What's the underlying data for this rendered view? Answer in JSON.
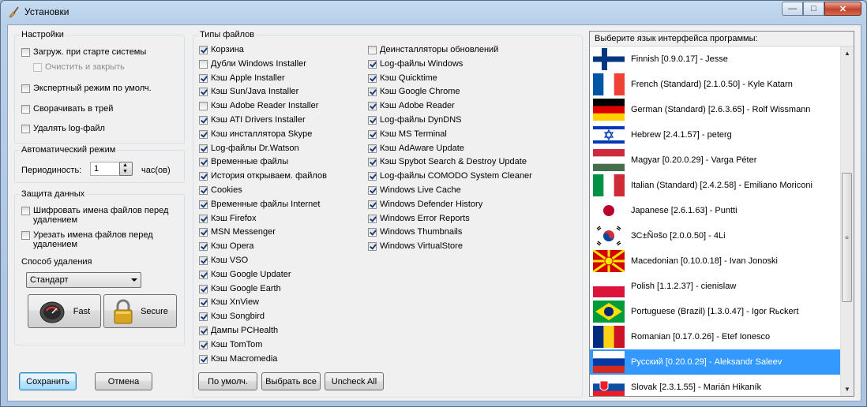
{
  "window": {
    "title": "Установки"
  },
  "settings": {
    "group_title": "Настройки",
    "load_startup": "Загруж. при старте системы",
    "clean_close": "Очистить и закрыть",
    "expert_mode": "Экспертный режим по умолч.",
    "minimize_tray": "Сворачивать в трей",
    "delete_log": "Удалять log-файл"
  },
  "auto_mode": {
    "group_title": "Автоматический режим",
    "period_label": "Периодиность:",
    "period_value": "1",
    "unit": "час(ов)"
  },
  "data_protection": {
    "group_title": "Защита данных",
    "encrypt_names": "Шифровать имена файлов перед удалением",
    "trim_names": "Урезать имена файлов перед удалением",
    "method_label": "Способ удаления",
    "method_value": "Стандарт",
    "fast_label": "Fast",
    "secure_label": "Secure"
  },
  "file_types": {
    "group_title": "Типы файлов",
    "col1": [
      {
        "label": "Корзина",
        "checked": true
      },
      {
        "label": "Дубли Windows Installer",
        "checked": false
      },
      {
        "label": "Кэш Apple Installer",
        "checked": true
      },
      {
        "label": "Кэш Sun/Java Installer",
        "checked": true
      },
      {
        "label": "Кэш Adobe Reader Installer",
        "checked": false
      },
      {
        "label": "Кэш ATI Drivers Installer",
        "checked": true
      },
      {
        "label": "Кэш инсталлятора Skype",
        "checked": true
      },
      {
        "label": "Log-файлы Dr.Watson",
        "checked": true
      },
      {
        "label": "Временные файлы",
        "checked": true
      },
      {
        "label": "История открываем. файлов",
        "checked": true
      },
      {
        "label": "Cookies",
        "checked": true
      },
      {
        "label": "Временные файлы Internet",
        "checked": true
      },
      {
        "label": "Кэш Firefox",
        "checked": true
      },
      {
        "label": "MSN Messenger",
        "checked": true
      },
      {
        "label": "Кэш Opera",
        "checked": true
      },
      {
        "label": "Кэш VSO",
        "checked": true
      },
      {
        "label": "Кэш Google Updater",
        "checked": true
      },
      {
        "label": "Кэш Google Earth",
        "checked": true
      },
      {
        "label": "Кэш XnView",
        "checked": true
      },
      {
        "label": "Кэш Songbird",
        "checked": true
      },
      {
        "label": "Дампы PCHealth",
        "checked": true
      },
      {
        "label": "Кэш TomTom",
        "checked": true
      },
      {
        "label": "Кэш Macromedia",
        "checked": true
      }
    ],
    "col2": [
      {
        "label": "Деинсталляторы обновлений",
        "checked": false
      },
      {
        "label": "Log-файлы Windows",
        "checked": true
      },
      {
        "label": "Кэш Quicktime",
        "checked": true
      },
      {
        "label": "Кэш Google Chrome",
        "checked": true
      },
      {
        "label": "Кэш Adobe Reader",
        "checked": true
      },
      {
        "label": "Log-файлы DynDNS",
        "checked": true
      },
      {
        "label": "Кэш MS Terminal",
        "checked": true
      },
      {
        "label": "Кэш AdAware Update",
        "checked": true
      },
      {
        "label": "Кэш Spybot Search & Destroy Update",
        "checked": true
      },
      {
        "label": "Log-файлы COMODO System Cleaner",
        "checked": true
      },
      {
        "label": "Windows Live Cache",
        "checked": true
      },
      {
        "label": "Windows Defender History",
        "checked": true
      },
      {
        "label": "Windows Error Reports",
        "checked": true
      },
      {
        "label": "Windows Thumbnails",
        "checked": true
      },
      {
        "label": "Windows VirtualStore",
        "checked": true
      }
    ],
    "btn_default": "По умолч.",
    "btn_select_all": "Выбрать все",
    "btn_uncheck_all": "Uncheck All"
  },
  "language": {
    "header": "Выберите язык интерфейса программы:",
    "items": [
      {
        "name": "Finnish [0.9.0.17] - Jesse",
        "flag": "finland-flag-icon"
      },
      {
        "name": "French (Standard) [2.1.0.50] - Kyle Katarn",
        "flag": "france-flag-icon"
      },
      {
        "name": "German (Standard) [2.6.3.65] - Rolf Wissmann",
        "flag": "germany-flag-icon"
      },
      {
        "name": "Hebrew [2.4.1.57] - peterg",
        "flag": "israel-flag-icon"
      },
      {
        "name": "Magyar [0.20.0.29] - Varga Péter",
        "flag": "hungary-flag-icon"
      },
      {
        "name": "Italian (Standard) [2.4.2.58] - Emiliano Moriconi",
        "flag": "italy-flag-icon"
      },
      {
        "name": "Japanese [2.6.1.63] - Puntti",
        "flag": "japan-flag-icon"
      },
      {
        "name": "ЗС±Ñ¤šo [2.0.0.50] - 4Li",
        "flag": "korea-flag-icon"
      },
      {
        "name": "Macedonian [0.10.0.18] - Ivan Jonoski",
        "flag": "macedonia-flag-icon"
      },
      {
        "name": "Polish [1.1.2.37] - cienislaw",
        "flag": "poland-flag-icon"
      },
      {
        "name": "Portuguese (Brazil) [1.3.0.47] - Igor Rьckert",
        "flag": "brazil-flag-icon"
      },
      {
        "name": "Romanian [0.17.0.26] - Etef Ionesco",
        "flag": "romania-flag-icon"
      },
      {
        "name": "Русский [0.20.0.29] - Aleksandr Saleev",
        "flag": "russia-flag-icon"
      },
      {
        "name": "Slovak [2.3.1.55] - Marián Hikaník",
        "flag": "slovakia-flag-icon"
      }
    ],
    "selected_index": 12
  },
  "footer": {
    "save": "Сохранить",
    "cancel": "Отмена"
  }
}
